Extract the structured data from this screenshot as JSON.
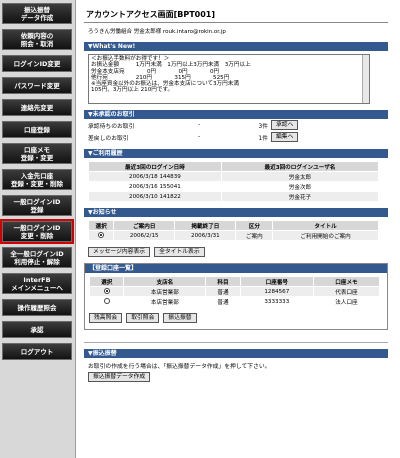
{
  "sidebar": {
    "items": [
      {
        "label": "振込振替\nデータ作成",
        "tall": true
      },
      {
        "label": "依頼内容の\n照会・取消",
        "tall": true
      },
      {
        "label": "ログインID変更",
        "tall": false
      },
      {
        "label": "パスワード変更",
        "tall": false
      },
      {
        "label": "連絡先変更",
        "tall": false
      },
      {
        "label": "口座登録",
        "tall": false
      },
      {
        "label": "口座メモ\n登録・変更",
        "tall": true
      },
      {
        "label": "入金先口座\n登録・変更・削除",
        "tall": true
      },
      {
        "label": "一般ログインID\n登録",
        "tall": true
      },
      {
        "label": "一般ログインID\n変更・削除",
        "tall": true,
        "selected": true
      },
      {
        "label": "全一般ログインID\n利用停止・解除",
        "tall": true
      },
      {
        "label": "InterFB\nメインメニューへ",
        "tall": true
      },
      {
        "label": "操作履歴照会",
        "tall": false
      },
      {
        "label": "承認",
        "tall": false
      },
      {
        "label": "ログアウト",
        "tall": false
      }
    ]
  },
  "page": {
    "title": "アカウントアクセス画面[BPT001]",
    "user": "ろうきん労働組合 労金太郎様 rouk.intaro@rokin.or.jp"
  },
  "whats_new": {
    "title": "▼What's New!",
    "text": "＜お振込手数料がお得です！＞\nお振込金額　　　1万円未満　1万円以上3万円未満　3万円以上\n労金本支店宛　　　　0円　　　　0円　　　　0円\n他行宛　　　　　210円　　　　315円　　　　525円\n※当座資金以外のお振込は、労金本支店について3万円未満\n105円、3万円以上 210円です。"
  },
  "pending": {
    "title": "▼未承認のお取引",
    "rows": [
      {
        "label": "承認待ちのお取引",
        "dash": "-",
        "count": "3件",
        "button": "承認へ"
      },
      {
        "label": "差戻しのお取引",
        "dash": "-",
        "count": "1件",
        "button": "編集へ"
      }
    ]
  },
  "history": {
    "title": "▼ご利用履歴",
    "headers": [
      "最近3回のログイン日時",
      "最近3回のログインユーザ名"
    ],
    "rows": [
      [
        "2006/3/18 144839",
        "労金太郎"
      ],
      [
        "2006/3/16 155041",
        "労金次郎"
      ],
      [
        "2006/3/10 141822",
        "労金花子"
      ]
    ]
  },
  "notices": {
    "title": "▼お知らせ",
    "headers": [
      "選択",
      "ご案内日",
      "掲載終了日",
      "区分",
      "タイトル"
    ],
    "rows": [
      [
        "2006/2/15",
        "2006/3/31",
        "ご案内",
        "ご利用開始のご案内"
      ]
    ],
    "buttons": [
      "メッセージ内容表示",
      "全タイトル表示"
    ]
  },
  "accounts": {
    "title": "【登録口座一覧】",
    "headers": [
      "選択",
      "支店名",
      "科目",
      "口座番号",
      "口座メモ"
    ],
    "rows": [
      [
        "本店営業部",
        "普通",
        "1284567",
        "代表口座"
      ],
      [
        "本店営業部",
        "普通",
        "3333333",
        "法人口座"
      ]
    ],
    "buttons": [
      "残高照会",
      "取引照会",
      "振込振替"
    ]
  },
  "transfer": {
    "title": "▼振込振替",
    "text": "お取引の作成を行う場合は、「振込振替データ作成」を押して下さい。",
    "button": "振込振替データ作成"
  }
}
